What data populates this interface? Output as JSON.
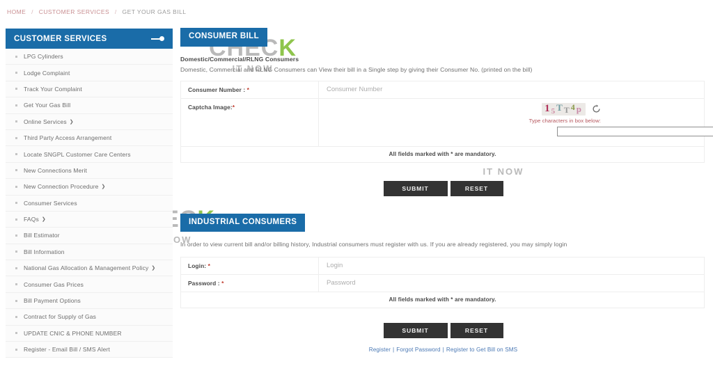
{
  "breadcrumb": {
    "items": [
      "HOME",
      "CUSTOMER SERVICES",
      "GET YOUR GAS BILL"
    ],
    "separator": "/"
  },
  "sidebar": {
    "title": "CUSTOMER SERVICES",
    "toggle_icon": "toggle-switch-icon",
    "items": [
      {
        "label": "LPG Cylinders",
        "caret": ""
      },
      {
        "label": "Lodge Complaint",
        "caret": ""
      },
      {
        "label": "Track Your Complaint",
        "caret": ""
      },
      {
        "label": "Get Your Gas Bill",
        "caret": ""
      },
      {
        "label": "Online Services",
        "caret": "❯"
      },
      {
        "label": "Third Party Access Arrangement",
        "caret": ""
      },
      {
        "label": "Locate SNGPL Customer Care Centers",
        "caret": ""
      },
      {
        "label": "New Connections Merit",
        "caret": ""
      },
      {
        "label": "New Connection Procedure",
        "caret": "❯"
      },
      {
        "label": "Consumer Services",
        "caret": ""
      },
      {
        "label": "FAQs",
        "caret": "❯"
      },
      {
        "label": "Bill Estimator",
        "caret": ""
      },
      {
        "label": "Bill Information",
        "caret": ""
      },
      {
        "label": "National Gas Allocation & Management Policy",
        "caret": "❯"
      },
      {
        "label": "Consumer Gas Prices",
        "caret": ""
      },
      {
        "label": "Bill Payment Options",
        "caret": ""
      },
      {
        "label": "Contract for Supply of Gas",
        "caret": ""
      },
      {
        "label": "UPDATE CNIC & PHONE NUMBER",
        "caret": ""
      },
      {
        "label": "Register - Email Bill / SMS Alert",
        "caret": ""
      }
    ]
  },
  "consumer_bill": {
    "badge": "CONSUMER BILL",
    "subtitle": "Domestic/Commercial/RLNG Consumers",
    "description": "Domestic, Commercial and RLNG Consumers can View their bill in a Single step by giving their Consumer No. (printed on the bill)",
    "fields": {
      "consumer_number_label": "Consumer Number : ",
      "consumer_number_placeholder": "Consumer Number",
      "consumer_number_value": "",
      "captcha_label": "Captcha Image:"
    },
    "captcha": {
      "characters": [
        {
          "char": "1",
          "color": "#b0315a",
          "size": 15,
          "offset": 0
        },
        {
          "char": "5",
          "color": "#cf8ca4",
          "size": 11,
          "offset": 3
        },
        {
          "char": "T",
          "color": "#6e9ba0",
          "size": 13,
          "offset": -1
        },
        {
          "char": "T",
          "color": "#9a9a9a",
          "size": 12,
          "offset": 2
        },
        {
          "char": "4",
          "color": "#8a9a4a",
          "size": 12,
          "offset": -2
        },
        {
          "char": "p",
          "color": "#c98aa8",
          "size": 13,
          "offset": 1
        }
      ],
      "refresh_icon": "refresh-icon",
      "hint": "Type characters in box below:",
      "input_value": ""
    },
    "mandatory_note": "All fields marked with * are mandatory.",
    "submit_label": "SUBMIT",
    "reset_label": "RESET"
  },
  "industrial": {
    "badge": "INDUSTRIAL CONSUMERS",
    "description": "In order to view current bill and/or billing history, Industrial consumers must register with us. If you are already registered, you may simply login",
    "fields": {
      "login_label": "Login: ",
      "login_placeholder": "Login",
      "login_value": "",
      "password_label": "Password : ",
      "password_placeholder": "Password",
      "password_value": ""
    },
    "mandatory_note": "All fields marked with * are mandatory.",
    "submit_label": "SUBMIT",
    "reset_label": "RESET",
    "links": [
      "Register",
      "Forgot Password",
      "Register to Get Bill on SMS"
    ],
    "link_separator": "|"
  },
  "watermark": {
    "big_text_left": "CHEC",
    "big_text_tick": "K",
    "small_text": "IT NOW"
  },
  "colors": {
    "brand_blue": "#1a6ca8",
    "button_dark": "#333333",
    "link_blue": "#4a78b4",
    "required_red": "#c0392b",
    "hint_red": "#b5555c",
    "watermark_gray": "#b9b9b9",
    "watermark_green": "#8fc54d"
  }
}
